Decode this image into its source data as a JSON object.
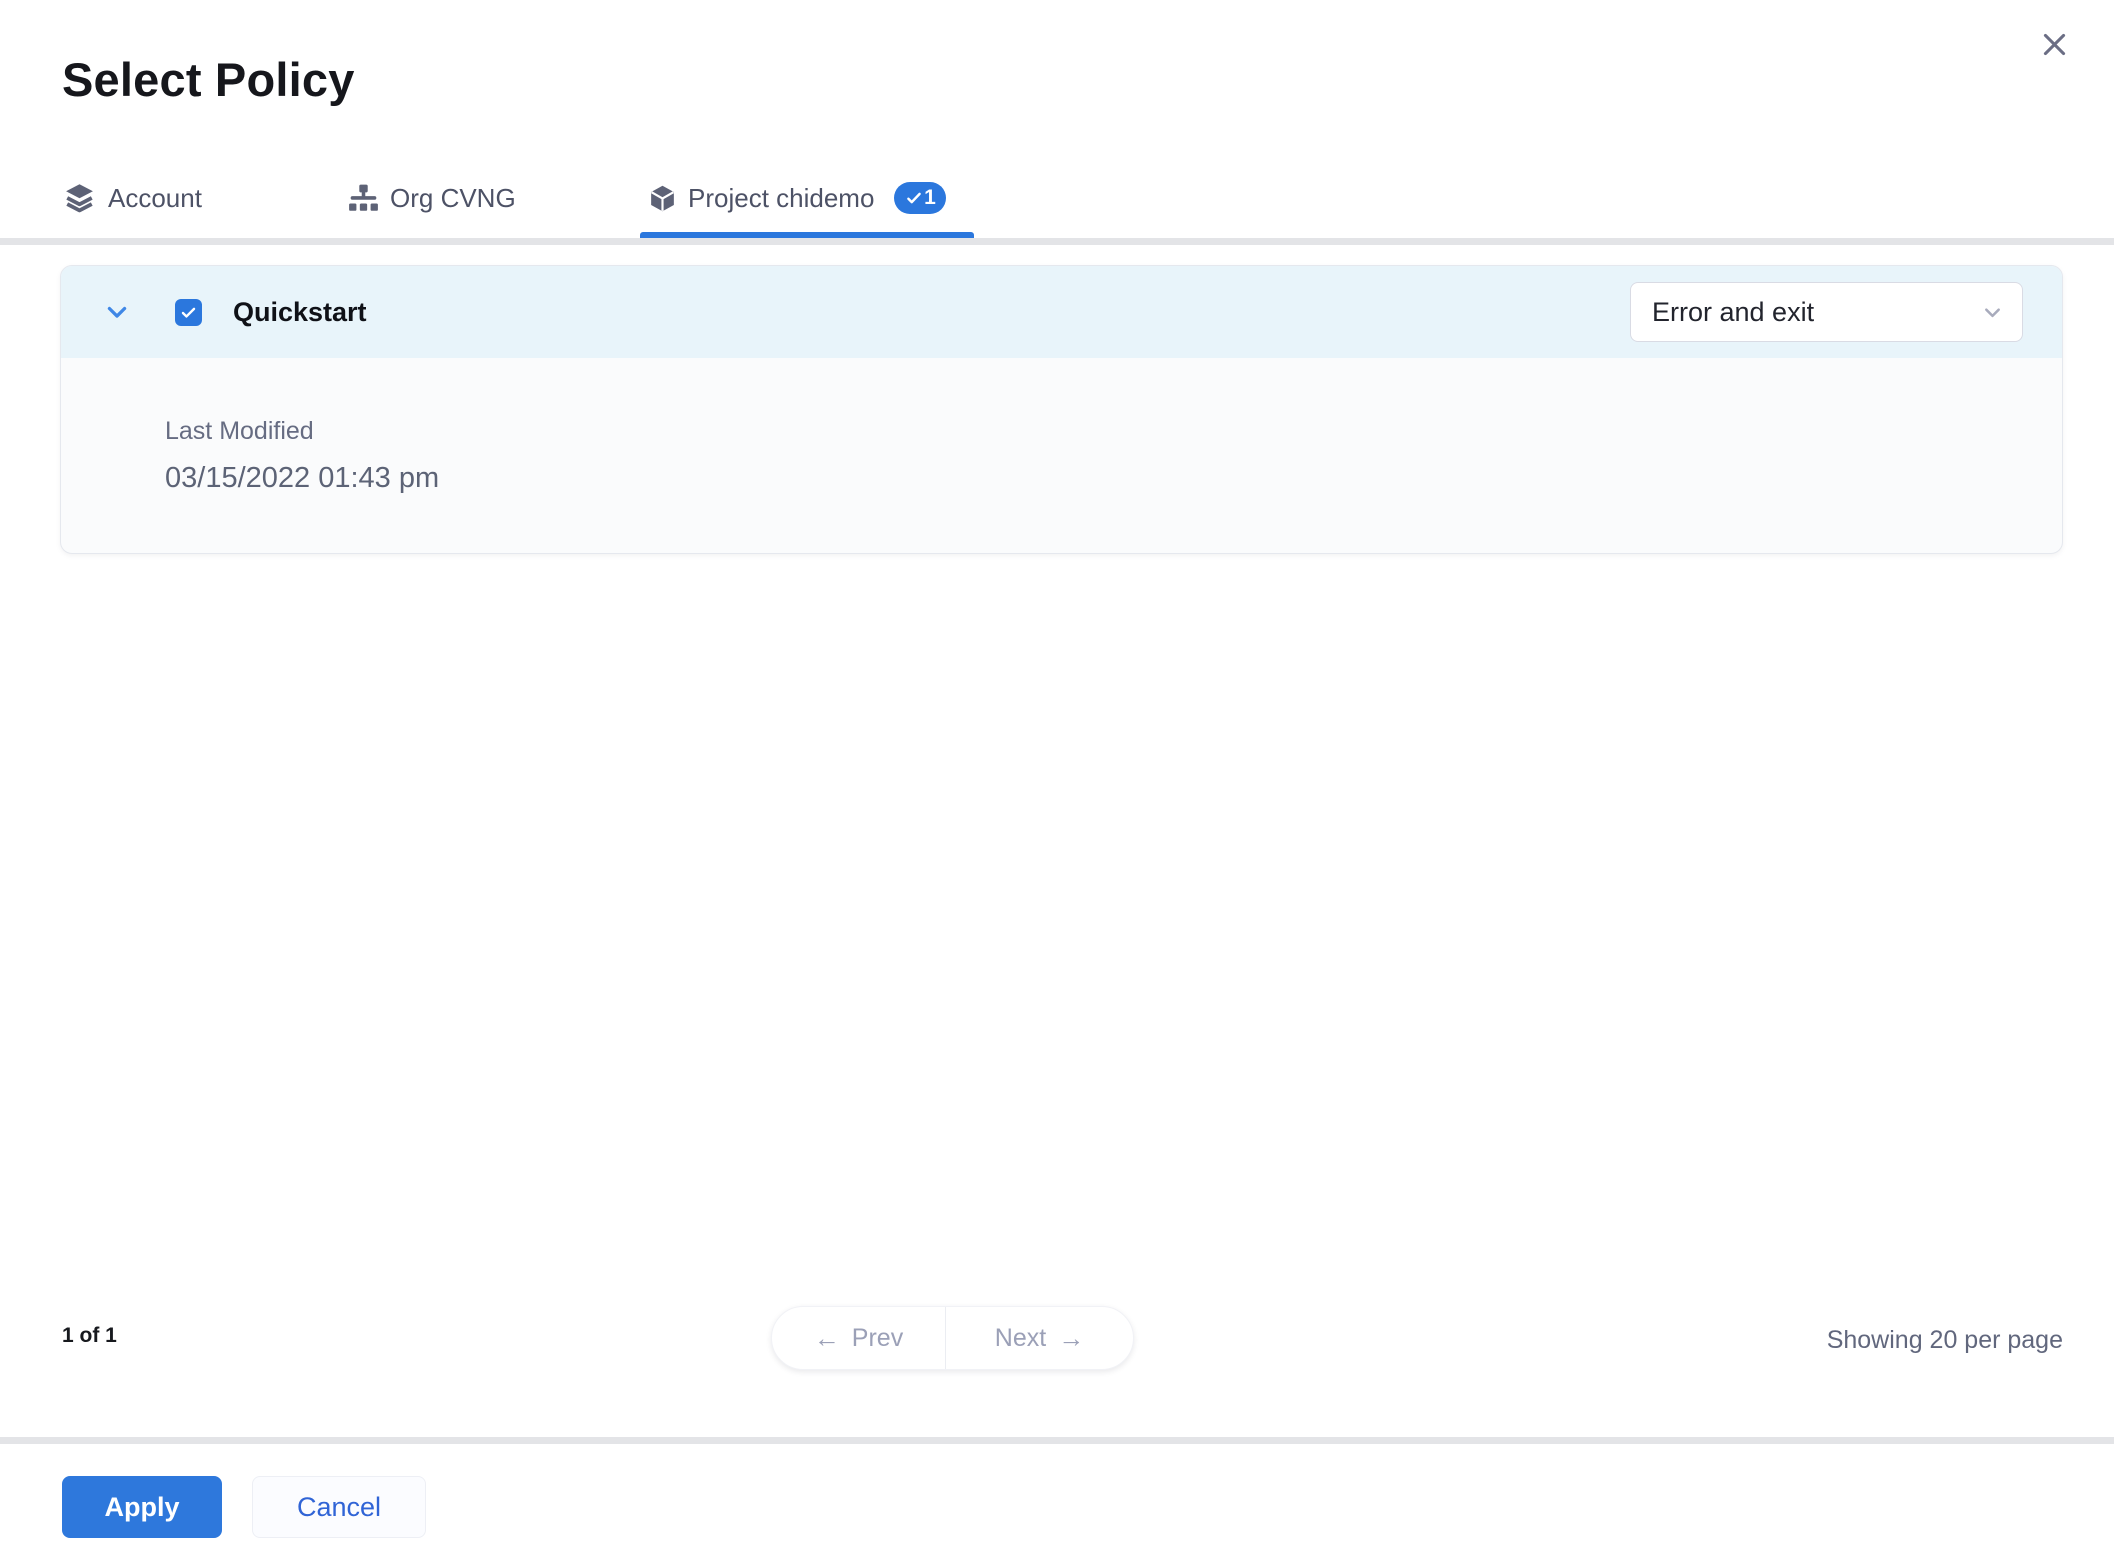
{
  "modal": {
    "title": "Select Policy"
  },
  "tabs": [
    {
      "label": "Account",
      "icon": "layers-icon",
      "active": false
    },
    {
      "label": "Org CVNG",
      "icon": "org-chart-icon",
      "active": false
    },
    {
      "label": "Project chidemo",
      "icon": "cube-icon",
      "active": true,
      "badge_count": "1"
    }
  ],
  "policy_list": {
    "rows": [
      {
        "name": "Quickstart",
        "checked": true,
        "expanded": true,
        "action_value": "Error and exit",
        "last_modified_label": "Last Modified",
        "last_modified_value": "03/15/2022 01:43 pm"
      }
    ]
  },
  "pagination": {
    "page_info": "1 of 1",
    "prev_arrow": "←",
    "prev_label": "Prev",
    "next_label": "Next",
    "next_arrow": "→",
    "per_page": "Showing 20 per page"
  },
  "footer": {
    "apply_label": "Apply",
    "cancel_label": "Cancel"
  },
  "icons": {
    "close": "close-icon",
    "account_tab": "layers-icon",
    "org_tab": "org-chart-icon",
    "project_tab": "cube-icon",
    "badge": "check-icon",
    "row_expander": "chevron-down-icon",
    "checkbox": "check-icon",
    "select_caret": "chevron-down-icon"
  },
  "colors": {
    "accent_blue": "#2b77dd",
    "apply_button_blue": "#2e78dc",
    "cancel_text_blue": "#3064d6",
    "row_header_bg": "#e8f4fa",
    "row_body_bg": "#fafbfc",
    "slate_text": "#4d5266",
    "muted_text": "#9ba0b7",
    "divider_gray": "#e3e4e7"
  }
}
